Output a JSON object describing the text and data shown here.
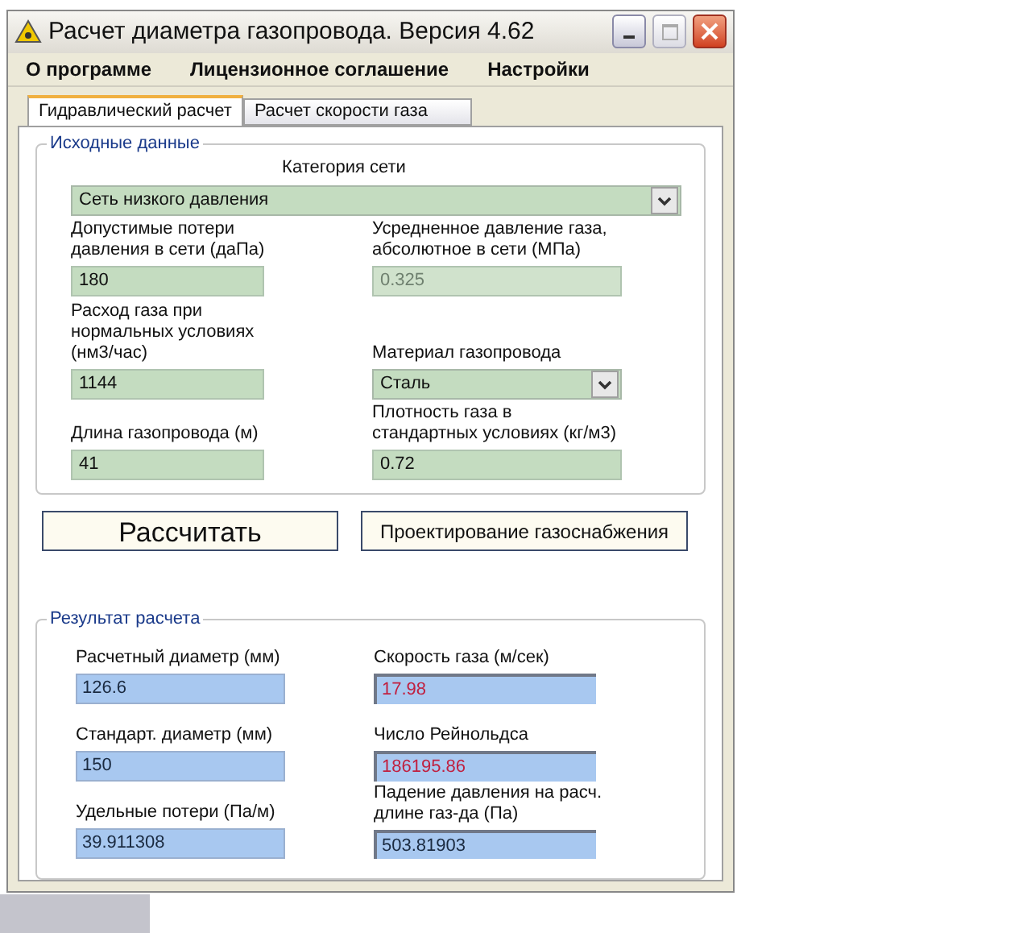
{
  "window": {
    "title": "Расчет диаметра газопровода. Версия 4.62"
  },
  "menu": [
    "О программе",
    "Лицензионное соглашение",
    "Настройки"
  ],
  "tabs": [
    {
      "label": "Гидравлический расчет",
      "selected": true
    },
    {
      "label": "Расчет скорости газа",
      "selected": false
    }
  ],
  "input_group": {
    "title": "Исходные данные",
    "category": {
      "label": "Категория сети",
      "value": "Сеть низкого давления"
    },
    "fields": [
      {
        "kind": "text",
        "label": "Допустимые потери давления в сети (даПа)",
        "value": "180",
        "disabled": false
      },
      {
        "kind": "text",
        "label": "Расход газа при нормальных условиях (нм3/час)",
        "value": "1144",
        "disabled": false
      },
      {
        "kind": "text",
        "label": "Длина газопровода (м)",
        "value": "41",
        "disabled": false
      },
      {
        "kind": "text",
        "label": "Усредненное давление газа, абсолютное в сети (МПа)",
        "value": "0.325",
        "disabled": true
      },
      {
        "kind": "dropdown",
        "label": "Материал газопровода",
        "value": "Сталь",
        "disabled": false
      },
      {
        "kind": "text",
        "label": "Плотность газа в стандартных условиях (кг/м3)",
        "value": "0.72",
        "disabled": false
      }
    ]
  },
  "buttons": [
    {
      "label": "Рассчитать",
      "kind": "primary"
    },
    {
      "label": "Проектирование газоснабжения",
      "kind": "secondary"
    }
  ],
  "result_group": {
    "title": "Результат расчета",
    "fields": [
      {
        "label": "Расчетный диаметр (мм)",
        "value": "126.6",
        "alert": false
      },
      {
        "label": "Стандарт. диаметр (мм)",
        "value": "150",
        "alert": false
      },
      {
        "label": "Удельные потери (Па/м)",
        "value": "39.911308",
        "alert": false
      },
      {
        "label": "Скорость газа (м/сек)",
        "value": "17.98",
        "alert": true
      },
      {
        "label": "Число Рейнольдса",
        "value": "186195.86",
        "alert": true
      },
      {
        "label": "Падение давления на расч. длине газ-да (Па)",
        "value": "503.81903",
        "alert": false
      }
    ]
  }
}
